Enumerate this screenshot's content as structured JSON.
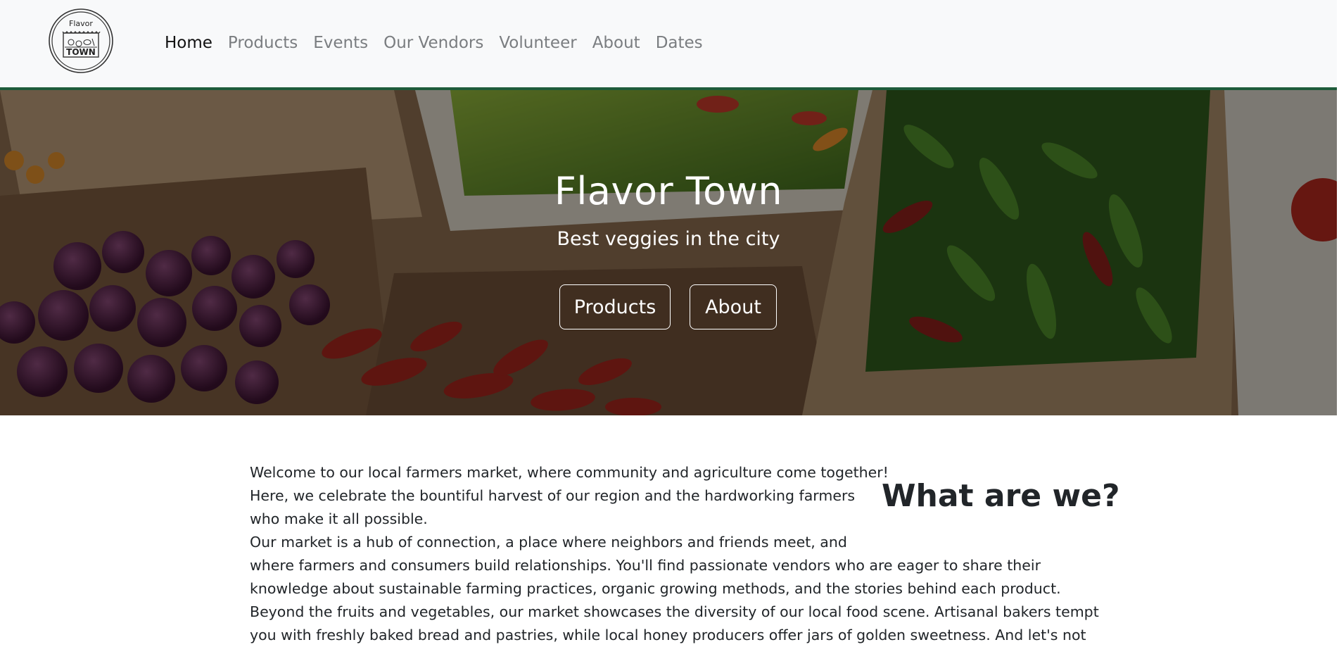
{
  "brand": {
    "logo_text_top": "Flavor",
    "logo_text_bottom": "TOWN"
  },
  "nav": {
    "items": [
      {
        "label": "Home",
        "active": true
      },
      {
        "label": "Products",
        "active": false
      },
      {
        "label": "Events",
        "active": false
      },
      {
        "label": "Our Vendors",
        "active": false
      },
      {
        "label": "Volunteer",
        "active": false
      },
      {
        "label": "About",
        "active": false
      },
      {
        "label": "Dates",
        "active": false
      }
    ]
  },
  "hero": {
    "title": "Flavor Town",
    "subtitle": "Best veggies in the city",
    "buttons": {
      "products": "Products",
      "about": "About"
    }
  },
  "content": {
    "heading": "What are we?",
    "lines": [
      "Welcome to our local farmers market, where community and agriculture come together!",
      "Here, we celebrate the bountiful harvest of our region and the hardworking farmers",
      "who make it all possible.",
      "Our market is a hub of connection, a place where neighbors and friends meet, and",
      "where farmers and consumers build relationships. You'll find passionate vendors who are eager to share their",
      "knowledge about sustainable farming practices, organic growing methods, and the stories behind each product.",
      "Beyond the fruits and vegetables, our market showcases the diversity of our local food scene. Artisanal bakers tempt",
      "you with freshly baked bread and pastries, while local honey producers offer jars of golden sweetness. And let's not"
    ]
  },
  "colors": {
    "nav_bg": "#f8f9fa",
    "nav_border": "#1e5b3a",
    "nav_link": "#7a7d80",
    "nav_active": "#111111",
    "text": "#212529"
  }
}
